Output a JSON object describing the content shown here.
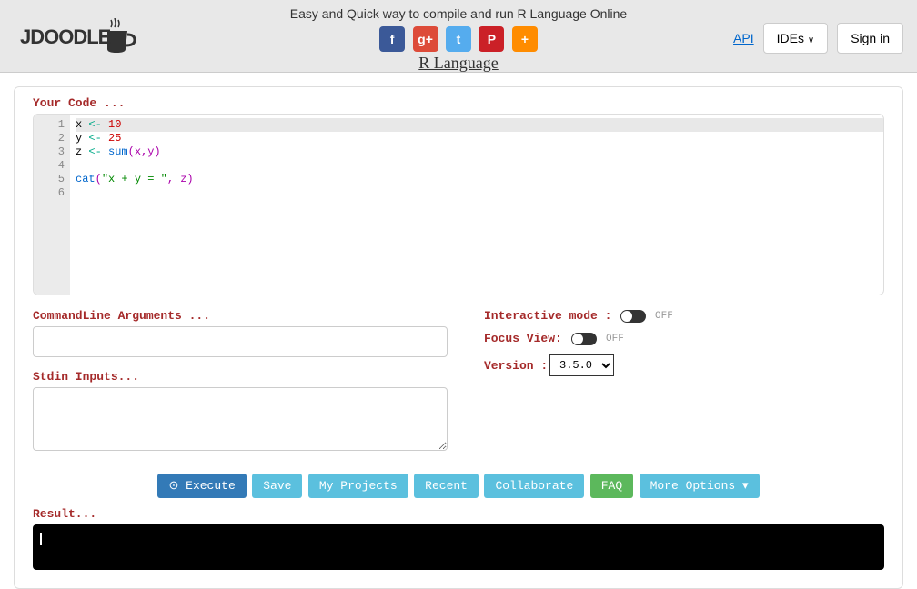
{
  "header": {
    "logo_text": "JDOODLE",
    "tagline": "Easy and Quick way to compile and run R Language Online",
    "lang_title": "R Language",
    "api": "API",
    "ides": "IDEs",
    "signin": "Sign in"
  },
  "social": {
    "fb": "f",
    "gp": "g+",
    "tw": "t",
    "pin": "P",
    "plus": "+"
  },
  "editor": {
    "label": "Your Code ...",
    "lines": [
      "1",
      "2",
      "3",
      "4",
      "5",
      "6"
    ]
  },
  "code": {
    "l1": {
      "v": "x",
      "op": "<-",
      "n": "10"
    },
    "l2": {
      "v": "y",
      "op": "<-",
      "n": "25"
    },
    "l3": {
      "v": "z",
      "op": "<-",
      "fn": "sum",
      "args": "(x,y)"
    },
    "l5": {
      "fn": "cat",
      "p1": "(",
      "str": "\"x + y = \"",
      "rest": ", z)"
    }
  },
  "inputs": {
    "cmd_label": "CommandLine Arguments ...",
    "stdin_label": "Stdin Inputs..."
  },
  "options": {
    "interactive_label": "Interactive mode :",
    "interactive_state": "OFF",
    "focus_label": "Focus View:",
    "focus_state": "OFF",
    "version_label": "Version :",
    "version_value": "3.5.0"
  },
  "buttons": {
    "execute": "Execute",
    "save": "Save",
    "projects": "My Projects",
    "recent": "Recent",
    "collaborate": "Collaborate",
    "faq": "FAQ",
    "more": "More Options"
  },
  "result": {
    "label": "Result..."
  }
}
